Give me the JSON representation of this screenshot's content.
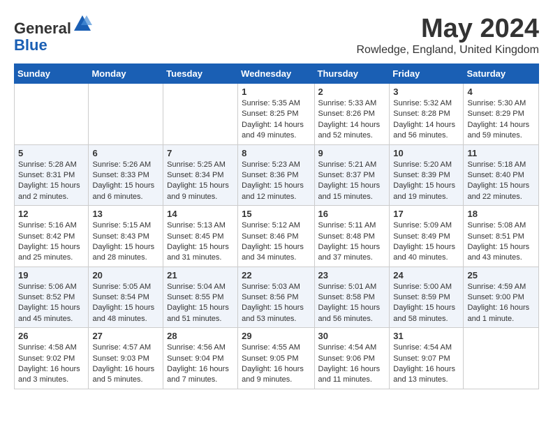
{
  "header": {
    "logo_line1": "General",
    "logo_line2": "Blue",
    "month_title": "May 2024",
    "location": "Rowledge, England, United Kingdom"
  },
  "weekdays": [
    "Sunday",
    "Monday",
    "Tuesday",
    "Wednesday",
    "Thursday",
    "Friday",
    "Saturday"
  ],
  "weeks": [
    [
      {
        "day": "",
        "content": ""
      },
      {
        "day": "",
        "content": ""
      },
      {
        "day": "",
        "content": ""
      },
      {
        "day": "1",
        "content": "Sunrise: 5:35 AM\nSunset: 8:25 PM\nDaylight: 14 hours\nand 49 minutes."
      },
      {
        "day": "2",
        "content": "Sunrise: 5:33 AM\nSunset: 8:26 PM\nDaylight: 14 hours\nand 52 minutes."
      },
      {
        "day": "3",
        "content": "Sunrise: 5:32 AM\nSunset: 8:28 PM\nDaylight: 14 hours\nand 56 minutes."
      },
      {
        "day": "4",
        "content": "Sunrise: 5:30 AM\nSunset: 8:29 PM\nDaylight: 14 hours\nand 59 minutes."
      }
    ],
    [
      {
        "day": "5",
        "content": "Sunrise: 5:28 AM\nSunset: 8:31 PM\nDaylight: 15 hours\nand 2 minutes."
      },
      {
        "day": "6",
        "content": "Sunrise: 5:26 AM\nSunset: 8:33 PM\nDaylight: 15 hours\nand 6 minutes."
      },
      {
        "day": "7",
        "content": "Sunrise: 5:25 AM\nSunset: 8:34 PM\nDaylight: 15 hours\nand 9 minutes."
      },
      {
        "day": "8",
        "content": "Sunrise: 5:23 AM\nSunset: 8:36 PM\nDaylight: 15 hours\nand 12 minutes."
      },
      {
        "day": "9",
        "content": "Sunrise: 5:21 AM\nSunset: 8:37 PM\nDaylight: 15 hours\nand 15 minutes."
      },
      {
        "day": "10",
        "content": "Sunrise: 5:20 AM\nSunset: 8:39 PM\nDaylight: 15 hours\nand 19 minutes."
      },
      {
        "day": "11",
        "content": "Sunrise: 5:18 AM\nSunset: 8:40 PM\nDaylight: 15 hours\nand 22 minutes."
      }
    ],
    [
      {
        "day": "12",
        "content": "Sunrise: 5:16 AM\nSunset: 8:42 PM\nDaylight: 15 hours\nand 25 minutes."
      },
      {
        "day": "13",
        "content": "Sunrise: 5:15 AM\nSunset: 8:43 PM\nDaylight: 15 hours\nand 28 minutes."
      },
      {
        "day": "14",
        "content": "Sunrise: 5:13 AM\nSunset: 8:45 PM\nDaylight: 15 hours\nand 31 minutes."
      },
      {
        "day": "15",
        "content": "Sunrise: 5:12 AM\nSunset: 8:46 PM\nDaylight: 15 hours\nand 34 minutes."
      },
      {
        "day": "16",
        "content": "Sunrise: 5:11 AM\nSunset: 8:48 PM\nDaylight: 15 hours\nand 37 minutes."
      },
      {
        "day": "17",
        "content": "Sunrise: 5:09 AM\nSunset: 8:49 PM\nDaylight: 15 hours\nand 40 minutes."
      },
      {
        "day": "18",
        "content": "Sunrise: 5:08 AM\nSunset: 8:51 PM\nDaylight: 15 hours\nand 43 minutes."
      }
    ],
    [
      {
        "day": "19",
        "content": "Sunrise: 5:06 AM\nSunset: 8:52 PM\nDaylight: 15 hours\nand 45 minutes."
      },
      {
        "day": "20",
        "content": "Sunrise: 5:05 AM\nSunset: 8:54 PM\nDaylight: 15 hours\nand 48 minutes."
      },
      {
        "day": "21",
        "content": "Sunrise: 5:04 AM\nSunset: 8:55 PM\nDaylight: 15 hours\nand 51 minutes."
      },
      {
        "day": "22",
        "content": "Sunrise: 5:03 AM\nSunset: 8:56 PM\nDaylight: 15 hours\nand 53 minutes."
      },
      {
        "day": "23",
        "content": "Sunrise: 5:01 AM\nSunset: 8:58 PM\nDaylight: 15 hours\nand 56 minutes."
      },
      {
        "day": "24",
        "content": "Sunrise: 5:00 AM\nSunset: 8:59 PM\nDaylight: 15 hours\nand 58 minutes."
      },
      {
        "day": "25",
        "content": "Sunrise: 4:59 AM\nSunset: 9:00 PM\nDaylight: 16 hours\nand 1 minute."
      }
    ],
    [
      {
        "day": "26",
        "content": "Sunrise: 4:58 AM\nSunset: 9:02 PM\nDaylight: 16 hours\nand 3 minutes."
      },
      {
        "day": "27",
        "content": "Sunrise: 4:57 AM\nSunset: 9:03 PM\nDaylight: 16 hours\nand 5 minutes."
      },
      {
        "day": "28",
        "content": "Sunrise: 4:56 AM\nSunset: 9:04 PM\nDaylight: 16 hours\nand 7 minutes."
      },
      {
        "day": "29",
        "content": "Sunrise: 4:55 AM\nSunset: 9:05 PM\nDaylight: 16 hours\nand 9 minutes."
      },
      {
        "day": "30",
        "content": "Sunrise: 4:54 AM\nSunset: 9:06 PM\nDaylight: 16 hours\nand 11 minutes."
      },
      {
        "day": "31",
        "content": "Sunrise: 4:54 AM\nSunset: 9:07 PM\nDaylight: 16 hours\nand 13 minutes."
      },
      {
        "day": "",
        "content": ""
      }
    ]
  ]
}
